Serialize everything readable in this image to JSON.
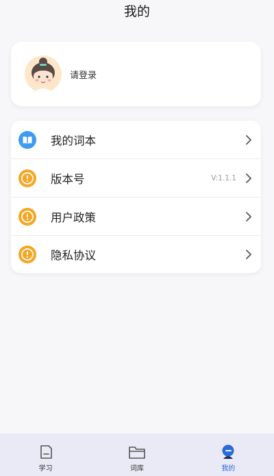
{
  "header": {
    "title": "我的"
  },
  "profile": {
    "login_text": "请登录",
    "avatar_icon": "user-avatar"
  },
  "menu": {
    "items": [
      {
        "label": "我的词本",
        "value": "",
        "icon": "book-icon",
        "icon_color": "#3d9bf0"
      },
      {
        "label": "版本号",
        "value": "V:1.1.1",
        "icon": "info-icon",
        "icon_color": "#f5a623"
      },
      {
        "label": "用户政策",
        "value": "",
        "icon": "info-icon",
        "icon_color": "#f5a623"
      },
      {
        "label": "隐私协议",
        "value": "",
        "icon": "info-icon",
        "icon_color": "#f5a623"
      }
    ]
  },
  "tabbar": {
    "active_color": "#2a6bd8",
    "tabs": [
      {
        "label": "学习",
        "icon": "study-icon"
      },
      {
        "label": "词库",
        "icon": "folder-icon"
      },
      {
        "label": "我的",
        "icon": "profile-icon"
      }
    ],
    "active_index": 2
  }
}
